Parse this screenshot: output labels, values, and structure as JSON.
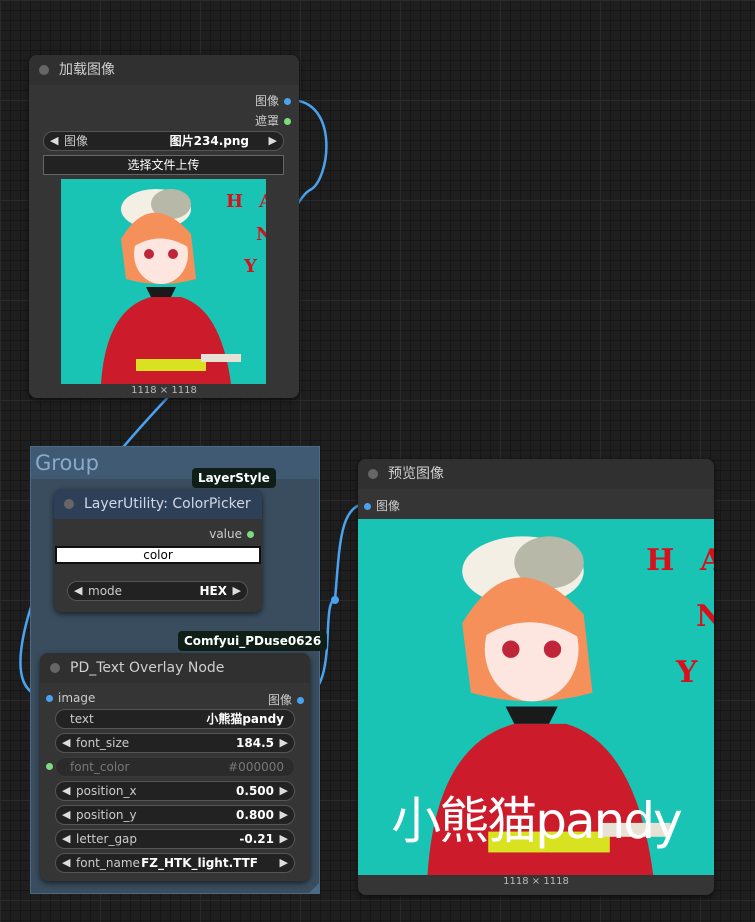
{
  "load_image_node": {
    "title": "加载图像",
    "outputs": {
      "image": "图像",
      "mask": "遮罩"
    },
    "image_widget": {
      "label": "图像",
      "value": "图片234.png"
    },
    "upload_button": "选择文件上传",
    "image_size": "1118 × 1118",
    "image_text": {
      "l1": "H",
      "l2": "A",
      "l3": "N",
      "l4": "Y"
    }
  },
  "group": {
    "title": "Group"
  },
  "color_picker_node": {
    "badge": "LayerStyle",
    "title": "LayerUtility: ColorPicker",
    "output_value": "value",
    "color_field": "color",
    "mode_widget": {
      "label": "mode",
      "value": "HEX"
    }
  },
  "text_overlay_node": {
    "badge": "Comfyui_PDuse0626",
    "title": "PD_Text Overlay Node",
    "input_image": "image",
    "output_image": "图像",
    "widgets": {
      "text": {
        "label": "text",
        "value": "小熊猫pandy"
      },
      "font_size": {
        "label": "font_size",
        "value": "184.5"
      },
      "font_color": {
        "label": "font_color",
        "value": "#000000"
      },
      "position_x": {
        "label": "position_x",
        "value": "0.500"
      },
      "position_y": {
        "label": "position_y",
        "value": "0.800"
      },
      "letter_gap": {
        "label": "letter_gap",
        "value": "-0.21"
      },
      "font_name": {
        "label": "font_name",
        "value": "FZ_HTK_light.TTF"
      }
    }
  },
  "preview_node": {
    "title": "预览图像",
    "input_image": "图像",
    "overlay_text": "小熊猫pandy",
    "image_size": "1118 × 1118",
    "image_text": {
      "l1": "H",
      "l2": "A",
      "l3": "N",
      "l4": "Y"
    }
  },
  "colors": {
    "image_link": "#4aa3f0",
    "mask_pin": "#7ddb7d",
    "value_pin": "#7ddb7d",
    "group": "#3a4d5e"
  }
}
